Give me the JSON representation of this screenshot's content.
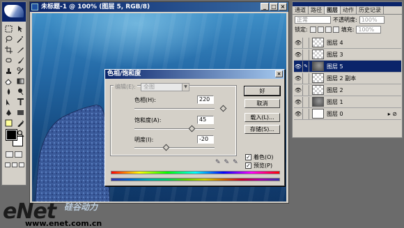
{
  "document": {
    "title": "未标题-1 @ 100% (图层 5, RGB/8)"
  },
  "dialog": {
    "title": "色相/饱和度",
    "edit_label": "编辑(E):",
    "edit_value": "全图",
    "hue_label": "色相(H):",
    "hue_value": "220",
    "saturation_label": "饱和度(A):",
    "saturation_value": "45",
    "lightness_label": "明度(I):",
    "lightness_value": "-20",
    "ok": "好",
    "cancel": "取消",
    "load": "载入(L)...",
    "save": "存储(S)...",
    "colorize_label": "着色(O)",
    "colorize_checked": true,
    "preview_label": "预览(P)",
    "preview_checked": true,
    "hue_range": [
      -180,
      180
    ],
    "saturation_range": [
      -100,
      100
    ],
    "lightness_range": [
      -100,
      100
    ]
  },
  "layers_panel": {
    "tabs": [
      "通道",
      "路径",
      "图层",
      "动作",
      "历史记录"
    ],
    "active_tab": "图层",
    "blend_mode": "正常",
    "opacity_label": "不透明度:",
    "opacity_value": "100%",
    "lock_label": "锁定:",
    "fill_label": "填充:",
    "fill_value": "100%",
    "layers": [
      {
        "name": "图层 4",
        "thumb": "checker",
        "selected": false
      },
      {
        "name": "图层 3",
        "thumb": "checker",
        "selected": false
      },
      {
        "name": "图层 5",
        "thumb": "rocky",
        "selected": true
      },
      {
        "name": "图层 2 副本",
        "thumb": "checker",
        "selected": false
      },
      {
        "name": "图层 2",
        "thumb": "checker",
        "selected": false
      },
      {
        "name": "图层 1",
        "thumb": "rocky",
        "selected": false
      },
      {
        "name": "图层 0",
        "thumb": "white",
        "selected": false,
        "has_fx": true
      }
    ]
  },
  "watermark": {
    "brand": "eNet",
    "tagline": "硅谷动力",
    "url": "www.enet.com.cn"
  },
  "colors": {
    "title_bar": "#0a246a",
    "panel_bg": "#d4d0c8",
    "ocean": "#256ba8",
    "foreground": "#000000",
    "background": "#ffffff"
  }
}
